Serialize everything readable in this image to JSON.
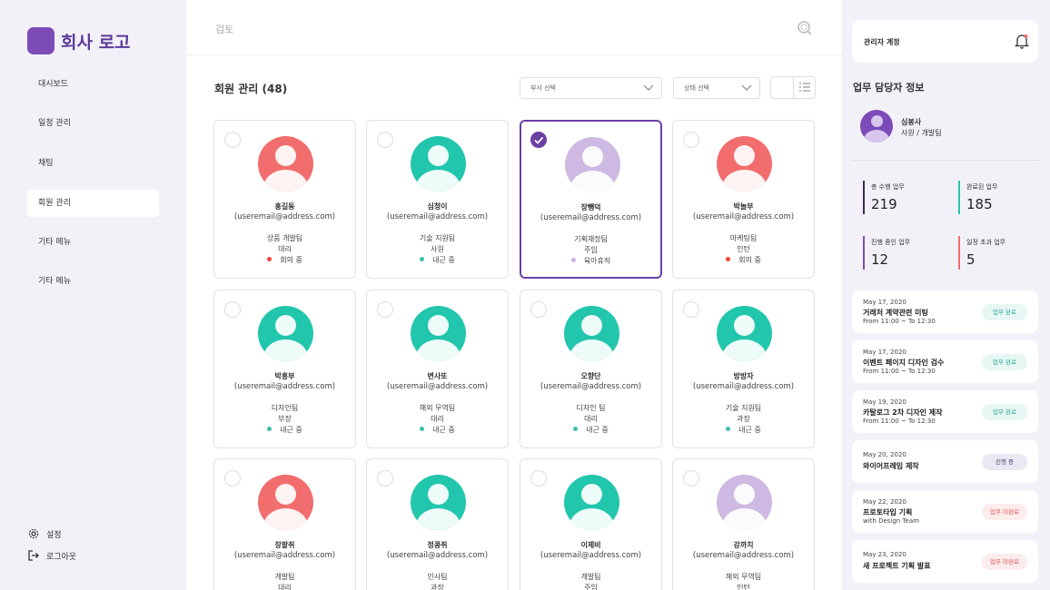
{
  "app": {
    "logo_text": "회사 로고"
  },
  "sidebar": {
    "items": [
      {
        "label": "대시보드"
      },
      {
        "label": "일정 관리"
      },
      {
        "label": "채팅"
      },
      {
        "label": "회원 관리"
      },
      {
        "label": "기타 메뉴"
      },
      {
        "label": "기타 메뉴"
      }
    ],
    "active_index": 3,
    "settings_label": "설정",
    "logout_label": "로그아웃"
  },
  "topbar": {
    "search_placeholder": "검토"
  },
  "main": {
    "title": "회원 관리 (48)",
    "dept_select": "부서 선택",
    "status_select": "상태 선택"
  },
  "colors": {
    "coral": "#f26d6d",
    "teal": "#22c6ad",
    "lavender": "#cdb9e2",
    "accent": "#6b3fa6",
    "status_red": "#ef4444",
    "status_teal": "#3fbfb0",
    "status_purple": "#c7b3e0"
  },
  "members": [
    {
      "name": "홍길동",
      "email": "(useremail@address.com)",
      "dept": "상품 개발팀",
      "rank": "대리",
      "status": "회의 중",
      "status_color": "#ef4444",
      "avatar_color": "#f26d6d",
      "selected": false
    },
    {
      "name": "심청이",
      "email": "(useremail@address.com)",
      "dept": "기술 지원팀",
      "rank": "사원",
      "status": "내근 중",
      "status_color": "#3fbfb0",
      "avatar_color": "#22c6ad",
      "selected": false
    },
    {
      "name": "장뺑덕",
      "email": "(useremail@address.com)",
      "dept": "기획재정팀",
      "rank": "주임",
      "status": "육아휴직",
      "status_color": "#c7b3e0",
      "avatar_color": "#cdb9e2",
      "selected": true
    },
    {
      "name": "박놀부",
      "email": "(useremail@address.com)",
      "dept": "마케팅팀",
      "rank": "인턴",
      "status": "회의 중",
      "status_color": "#ef4444",
      "avatar_color": "#f26d6d",
      "selected": false
    },
    {
      "name": "박흥부",
      "email": "(useremail@address.com)",
      "dept": "디자인팀",
      "rank": "부장",
      "status": "내근 중",
      "status_color": "#3fbfb0",
      "avatar_color": "#22c6ad",
      "selected": false
    },
    {
      "name": "변사또",
      "email": "(useremail@address.com)",
      "dept": "해외 무역팀",
      "rank": "대리",
      "status": "내근 중",
      "status_color": "#3fbfb0",
      "avatar_color": "#22c6ad",
      "selected": false
    },
    {
      "name": "오향단",
      "email": "(useremail@address.com)",
      "dept": "디자인 팀",
      "rank": "대리",
      "status": "내근 중",
      "status_color": "#3fbfb0",
      "avatar_color": "#22c6ad",
      "selected": false
    },
    {
      "name": "방방자",
      "email": "(useremail@address.com)",
      "dept": "기술 지원팀",
      "rank": "과장",
      "status": "내근 중",
      "status_color": "#3fbfb0",
      "avatar_color": "#22c6ad",
      "selected": false
    },
    {
      "name": "장팥쥐",
      "email": "(useremail@address.com)",
      "dept": "개발팀",
      "rank": "대리",
      "status": "",
      "status_color": "",
      "avatar_color": "#f26d6d",
      "selected": false
    },
    {
      "name": "정콩쥐",
      "email": "(useremail@address.com)",
      "dept": "인사팀",
      "rank": "과장",
      "status": "",
      "status_color": "",
      "avatar_color": "#22c6ad",
      "selected": false
    },
    {
      "name": "이제비",
      "email": "(useremail@address.com)",
      "dept": "개발팀",
      "rank": "주임",
      "status": "",
      "status_color": "",
      "avatar_color": "#22c6ad",
      "selected": false
    },
    {
      "name": "강까치",
      "email": "(useremail@address.com)",
      "dept": "해외 무역팀",
      "rank": "인턴",
      "status": "",
      "status_color": "",
      "avatar_color": "#cdb9e2",
      "selected": false
    }
  ],
  "right_panel": {
    "account_label": "관리자 계정",
    "manager_title": "업무 담당자 정보",
    "manager_name": "심봉사",
    "manager_role": "사원 / 개발팀",
    "stats": [
      {
        "label": "총 수행 업무",
        "value": "219",
        "color": "#3d2a5a"
      },
      {
        "label": "완료된 업무",
        "value": "185",
        "color": "#22c6ad"
      },
      {
        "label": "진행 중인 업무",
        "value": "12",
        "color": "#7c4bb8"
      },
      {
        "label": "일정 초과 업무",
        "value": "5",
        "color": "#f26d6d"
      }
    ],
    "tasks": [
      {
        "date": "May 17, 2020",
        "title": "거래처  계약관련 미팅",
        "sub": "From 11:00 ~ To 12:30",
        "badge": "업무 완료",
        "badge_color": "#2aa594",
        "badge_bg": "#e6f7f4"
      },
      {
        "date": "May 17, 2020",
        "title": "이벤트 페이지 디자인 검수",
        "sub": "From 11:00 ~ To 12:30",
        "badge": "업무 완료",
        "badge_color": "#2aa594",
        "badge_bg": "#e6f7f4"
      },
      {
        "date": "May 19, 2020",
        "title": "카탈로그 2차 디자인 제작",
        "sub": "From 11:00 ~ To 12:30",
        "badge": "업무 완료",
        "badge_color": "#2aa594",
        "badge_bg": "#e6f7f4"
      },
      {
        "date": "May 20, 2020",
        "title": "와이어프레임 제작",
        "sub": "",
        "badge": "진행 중",
        "badge_color": "#4a3a6a",
        "badge_bg": "#ece8f3"
      },
      {
        "date": "May 22, 2020",
        "title": "프로토타입 기획",
        "sub": "with Design Team",
        "badge": "업무 미완료",
        "badge_color": "#e0555a",
        "badge_bg": "#fdecec"
      },
      {
        "date": "May 23, 2020",
        "title": "새 프로젝트 기획 발표",
        "sub": "",
        "badge": "업무 미완료",
        "badge_color": "#e0555a",
        "badge_bg": "#fdecec"
      }
    ]
  }
}
